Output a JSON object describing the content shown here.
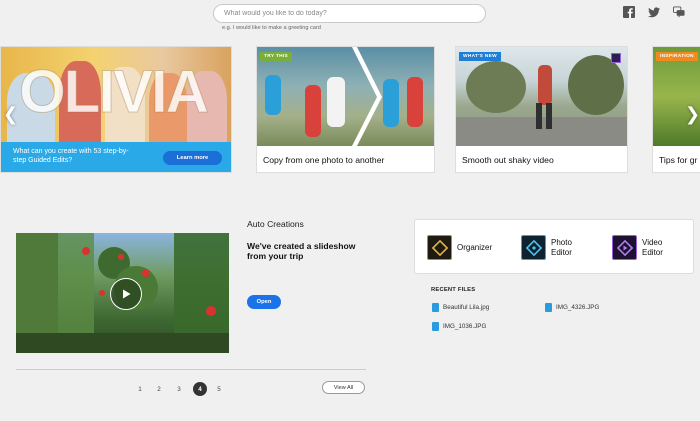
{
  "search": {
    "placeholder": "What would you like to do today?",
    "hint": "e.g. I would like to make a greeting card"
  },
  "carousel": {
    "hero": {
      "name_art": "OLIVIA",
      "text": "What can you create with 53 step-by-step Guided Edits?",
      "button": "Learn more"
    },
    "cards": [
      {
        "tag": "TRY THIS",
        "tag_color": "#7ab03a",
        "title": "Copy from one photo to another"
      },
      {
        "tag": "WHAT'S NEW",
        "tag_color": "#1e7fd8",
        "title": "Smooth out shaky video"
      },
      {
        "tag": "INSPIRATION",
        "tag_color": "#f08a1c",
        "title": "Tips for gr"
      }
    ]
  },
  "auto": {
    "heading": "Auto Creations",
    "text": "We've created a slideshow from your trip",
    "button": "Open"
  },
  "pagination": {
    "pages": [
      "1",
      "2",
      "3",
      "4",
      "5"
    ],
    "active": "4",
    "view_all": "View All"
  },
  "apps": [
    {
      "label_line1": "Organizer",
      "label_line2": "",
      "icon_color": "#b58a2a"
    },
    {
      "label_line1": "Photo",
      "label_line2": "Editor",
      "icon_color": "#2fa8d8"
    },
    {
      "label_line1": "Video",
      "label_line2": "Editor",
      "icon_color": "#9b5de0"
    }
  ],
  "recent": {
    "heading": "RECENT FILES",
    "files": [
      "Beautiful Lila.jpg",
      "IMG_4326.JPG",
      "IMG_1036.JPG"
    ]
  },
  "colors": {
    "accent": "#1a73e8",
    "hero_bar": "#2aa9e8"
  }
}
